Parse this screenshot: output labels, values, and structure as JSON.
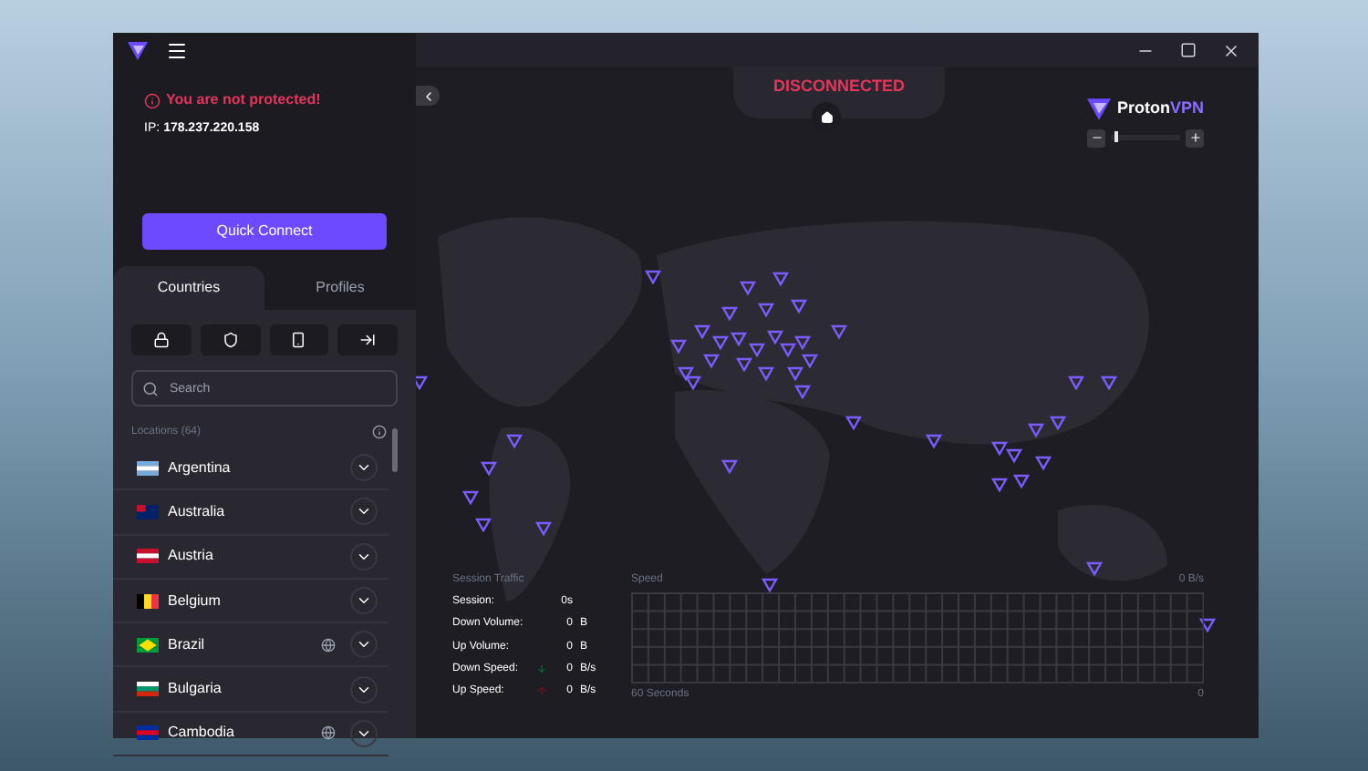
{
  "sidebar": {
    "warning": "You are not protected!",
    "ip_label": "IP:",
    "ip": "178.237.220.158",
    "quick_connect": "Quick Connect",
    "tabs": [
      {
        "label": "Countries",
        "selected": true
      },
      {
        "label": "Profiles",
        "selected": false
      }
    ],
    "filters": [
      {
        "kind": "lock"
      },
      {
        "kind": "shield"
      },
      {
        "kind": "p2p"
      },
      {
        "kind": "tor"
      }
    ],
    "search": {
      "placeholder": "Search"
    },
    "locations_label": "Locations (64)",
    "countries": [
      {
        "name": "Argentina",
        "kind": "ar",
        "tor": false
      },
      {
        "name": "Australia",
        "kind": "au",
        "tor": false
      },
      {
        "name": "Austria",
        "kind": "at",
        "tor": false
      },
      {
        "name": "Belgium",
        "kind": "be",
        "tor": false
      },
      {
        "name": "Brazil",
        "kind": "br",
        "tor": true
      },
      {
        "name": "Bulgaria",
        "kind": "bg",
        "tor": false
      },
      {
        "name": "Cambodia",
        "kind": "kh",
        "tor": true
      }
    ]
  },
  "map": {
    "status": "DISCONNECTED",
    "brand": {
      "first": "Proton",
      "second": "VPN"
    },
    "zoom": {
      "level": 0.05
    }
  },
  "traffic": {
    "title": "Session Traffic",
    "rows": [
      {
        "label": "Session:",
        "kind": "plain",
        "value": "0s"
      },
      {
        "label": "Down Volume:",
        "kind": "plain",
        "value": "0",
        "unit": "B"
      },
      {
        "label": "Up Volume:",
        "kind": "plain",
        "value": "0",
        "unit": "B"
      },
      {
        "label": "Down Speed:",
        "kind": "down",
        "value": "0",
        "unit": "B/s"
      },
      {
        "label": "Up Speed:",
        "kind": "up",
        "value": "0",
        "unit": "B/s"
      }
    ],
    "speed_title": "Speed",
    "speed_max": "0 B/s",
    "speed_span": "60 Seconds",
    "speed_end": "0"
  }
}
